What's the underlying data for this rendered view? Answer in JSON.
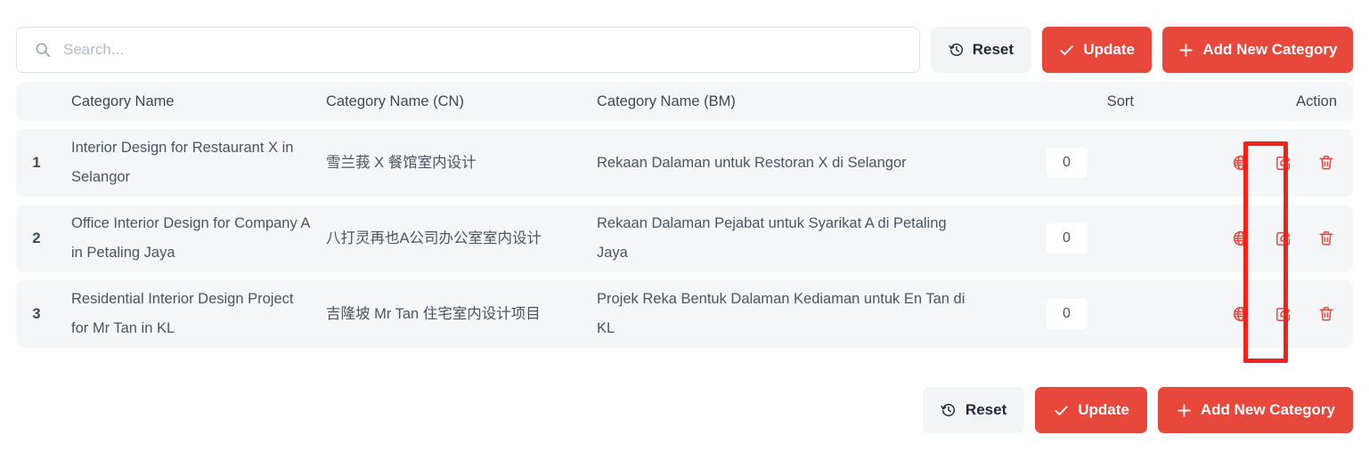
{
  "search": {
    "placeholder": "Search...",
    "value": "",
    "icon": "search-icon"
  },
  "toolbar": {
    "reset_label": "Reset",
    "reset_icon": "history-clock-icon",
    "update_label": "Update",
    "update_icon": "check-icon",
    "add_label": "Add New Category",
    "add_icon": "plus-icon"
  },
  "table": {
    "headers": {
      "num": "",
      "name": "Category Name",
      "name_cn": "Category Name (CN)",
      "name_bm": "Category Name (BM)",
      "sort": "Sort",
      "action": "Action"
    },
    "rows": [
      {
        "num": "1",
        "name": "Interior Design for Restaurant X in Selangor",
        "name_cn": "雪兰莪 X 餐馆室内设计",
        "name_bm": "Rekaan Dalaman untuk Restoran X di Selangor",
        "sort": "0"
      },
      {
        "num": "2",
        "name": "Office Interior Design for Company A in Petaling Jaya",
        "name_cn": "八打灵再也A公司办公室室内设计",
        "name_bm": "Rekaan Dalaman Pejabat untuk Syarikat A di Petaling Jaya",
        "sort": "0"
      },
      {
        "num": "3",
        "name": "Residential Interior Design Project for Mr Tan in KL",
        "name_cn": "吉隆坡 Mr Tan 住宅室内设计项目",
        "name_bm": "Projek Reka Bentuk Dalaman Kediaman untuk En Tan di KL",
        "sort": "0"
      }
    ],
    "action_icons": [
      "globe-icon",
      "edit-icon",
      "delete-icon"
    ]
  },
  "colors": {
    "primary_red": "#e8483c",
    "annotation_red": "#f0221a",
    "row_bg": "#f5f6f8",
    "reset_bg": "#f3f4f6",
    "text": "#4a5560"
  },
  "annotation": {
    "target": "globe-icon-column"
  }
}
